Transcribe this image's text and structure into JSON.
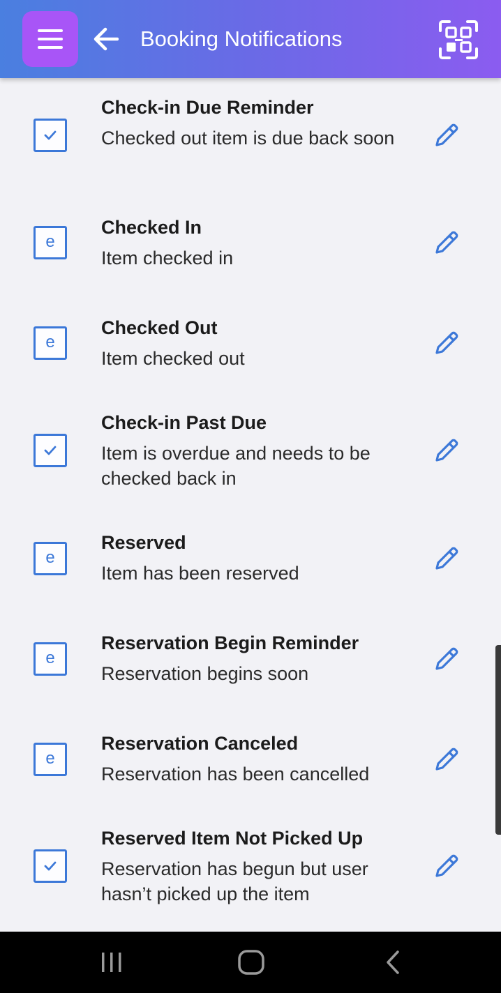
{
  "header": {
    "title": "Booking Notifications",
    "menu_icon": "hamburger-menu-icon",
    "back_icon": "arrow-left-icon",
    "scan_icon": "qr-scan-icon"
  },
  "colors": {
    "header_gradient_start": "#4a7fe0",
    "header_gradient_end": "#8b5cf0",
    "menu_button": "#a855f7",
    "accent": "#3c78d8",
    "background": "#f2f2f6",
    "navbar": "#000000"
  },
  "notifications": [
    {
      "title": "Check-in Due Reminder",
      "description": "Checked out item is due back soon",
      "status": "check"
    },
    {
      "title": "Checked In",
      "description": "Item checked in",
      "status": "e"
    },
    {
      "title": "Checked Out",
      "description": "Item checked out",
      "status": "e"
    },
    {
      "title": "Check-in Past Due",
      "description": "Item is overdue and needs to be checked back in",
      "status": "check"
    },
    {
      "title": "Reserved",
      "description": "Item has been reserved",
      "status": "e"
    },
    {
      "title": "Reservation Begin Reminder",
      "description": "Reservation begins soon",
      "status": "e"
    },
    {
      "title": "Reservation Canceled",
      "description": "Reservation has been cancelled",
      "status": "e"
    },
    {
      "title": "Reserved Item Not Picked Up",
      "description": "Reservation has begun but user hasn’t picked up the item",
      "status": "check"
    }
  ],
  "system_nav": {
    "recents_icon": "recent-apps-icon",
    "home_icon": "home-icon",
    "back_icon": "system-back-icon"
  }
}
